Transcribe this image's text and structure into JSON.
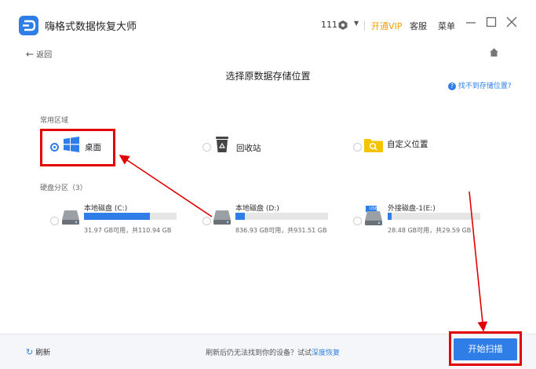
{
  "titlebar": {
    "app_title": "嗨格式数据恢复大师",
    "user_id": "111",
    "vip_label": "开通VIP",
    "service_label": "客服",
    "menu_label": "菜单"
  },
  "nav": {
    "back_label": "返回"
  },
  "page": {
    "title": "选择原数据存储位置",
    "help_link": "找不到存储位置?"
  },
  "common": {
    "section_label": "常用区域",
    "options": [
      {
        "label": "桌面",
        "selected": true
      },
      {
        "label": "回收站",
        "selected": false
      },
      {
        "label": "自定义位置",
        "selected": false
      }
    ]
  },
  "disks": {
    "section_label": "硬盘分区（3）",
    "items": [
      {
        "name": "本地磁盘 (C:)",
        "capacity": "31.97 GB可用，共110.94 GB",
        "used_fraction": 0.71
      },
      {
        "name": "本地磁盘 (D:)",
        "capacity": "836.93 GB可用，共931.51 GB",
        "used_fraction": 0.1
      },
      {
        "name": "外接磁盘-1(E:)",
        "capacity": "28.48 GB可用，共29.59 GB",
        "used_fraction": 0.04
      }
    ],
    "usb_badge": "USB"
  },
  "footer": {
    "refresh_label": "刷新",
    "hint_text": "刷新后仍无法找到你的设备？试试",
    "deep_recovery_link": "深度恢复",
    "scan_button": "开始扫描"
  },
  "colors": {
    "accent": "#2f7ee8",
    "vip": "#f2a100",
    "annotation": "#e30000",
    "folder": "#f5c400"
  }
}
